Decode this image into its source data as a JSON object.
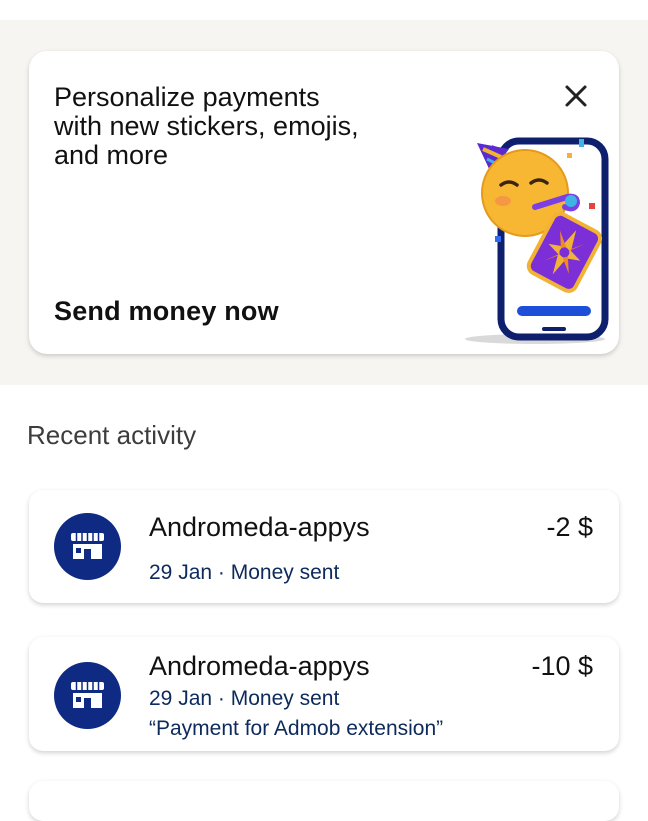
{
  "promo": {
    "line1": "Personalize payments",
    "line2": "with new stickers, emojis,",
    "line3": "and more",
    "cta": "Send money now",
    "close_icon": "close-icon",
    "illustration": "phone-with-party-emoji-and-sticker"
  },
  "activity": {
    "heading": "Recent activity",
    "transactions": [
      {
        "icon": "store-icon",
        "name": "Andromeda-appys",
        "amount": "-2 $",
        "date": "29 Jan",
        "separator": " · ",
        "type": "Money sent",
        "note": ""
      },
      {
        "icon": "store-icon",
        "name": "Andromeda-appys",
        "amount": "-10 $",
        "date": "29 Jan",
        "separator": " · ",
        "type": "Money sent",
        "note": "“Payment for Admob extension”"
      }
    ]
  },
  "colors": {
    "promo_background": "#f6f5f1",
    "avatar_navy": "#0e2a82",
    "subtext_navy": "#0d2a5c"
  }
}
